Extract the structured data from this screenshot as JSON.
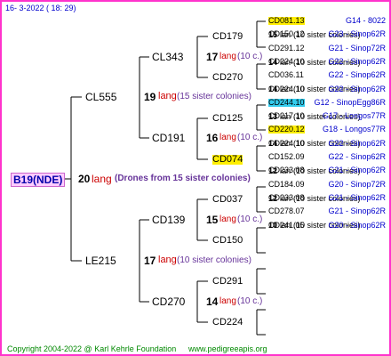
{
  "header": {
    "date": "16-  3-2022 ( 18: 29)"
  },
  "root": {
    "name": "B19(NDE)",
    "count": "20",
    "lang": "lang",
    "note": "(Drones from 15 sister colonies)"
  },
  "gen1": [
    {
      "name": "CL555",
      "count": "19",
      "lang": "lang",
      "note": "(15 sister colonies)"
    },
    {
      "name": "LE215",
      "count": "17",
      "lang": "lang",
      "note": "(10 sister colonies)"
    }
  ],
  "gen2": [
    {
      "name": "CL343",
      "count": "17",
      "lang": "lang",
      "note": "(10 c.)"
    },
    {
      "name": "CD191",
      "count": "16",
      "lang": "lang",
      "note": "(10 c.)"
    },
    {
      "name": "CD139",
      "count": "15",
      "lang": "lang",
      "note": "(10 c.)"
    },
    {
      "name": "CD270",
      "count": "14",
      "lang": "lang",
      "note": "(10 c.)"
    }
  ],
  "gen3": [
    {
      "name": "CD179"
    },
    {
      "name": "CD270"
    },
    {
      "name": "CD125"
    },
    {
      "name": "CD074"
    },
    {
      "name": "CD037"
    },
    {
      "name": "CD150"
    },
    {
      "name": "CD291"
    },
    {
      "name": "CD224"
    }
  ],
  "gen4": [
    {
      "code": "CD081.13",
      "right": "G14 - 8022",
      "count": "15",
      "lang": "lan",
      "note": "(10 sister colonies)"
    },
    {
      "code": "CD150.12",
      "right": "G23 - Sinop62R"
    },
    {
      "code": "CD291.12",
      "right": "G21 - Sinop72R",
      "count": "14",
      "lang": "lan",
      "note": "(10 sister colonies)"
    },
    {
      "code": "CD224.10",
      "right": "G22 - Sinop62R"
    },
    {
      "code": "CD036.11",
      "right": "G22 - Sinop62R",
      "count": "14",
      "lang": "lan",
      "note": "(10 sister colonies)"
    },
    {
      "code": "CD224.10",
      "right": "G22 - Sinop62R"
    },
    {
      "code": "CD244.10",
      "right": "G12 - SinopEgg86R",
      "count": "13",
      "lang": "lan",
      "note": "(10 sister colonies)"
    },
    {
      "code": "CD217.10",
      "right": "G17 - Longos77R"
    },
    {
      "code": "CD220.12",
      "right": "G18 - Longos77R",
      "count": "14",
      "lang": "lan",
      "note": "(10 sister colonies)"
    },
    {
      "code": "CD224.10",
      "right": "G22 - Sinop62R"
    },
    {
      "code": "CD152.09",
      "right": "G22 - Sinop62R",
      "count": "12",
      "lang": "lan",
      "note": "(10 sister colonies)"
    },
    {
      "code": "CD233.08",
      "right": "G21 - Sinop62R"
    },
    {
      "code": "CD184.09",
      "right": "G20 - Sinop72R",
      "count": "12",
      "lang": "lan",
      "note": "(10 sister colonies)"
    },
    {
      "code": "CD233.08",
      "right": "G21 - Sinop62R"
    },
    {
      "code": "CD278.07",
      "right": "G21 - Sinop62R",
      "count": "10",
      "lang": "lan",
      "note": "(10 sister colonies)"
    },
    {
      "code": "CD241.05",
      "right": "G20 - Sinop62R"
    }
  ],
  "footer": {
    "copyright": "Copyright 2004-2022 @ Karl Kehrle Foundation",
    "url": "www.pedigreeapis.org"
  },
  "colors": {
    "border": "#ff33cc",
    "highlight_yellow": "#ffee00",
    "highlight_cyan": "#33ccee",
    "lang": "#cc0000",
    "note": "#663399"
  }
}
